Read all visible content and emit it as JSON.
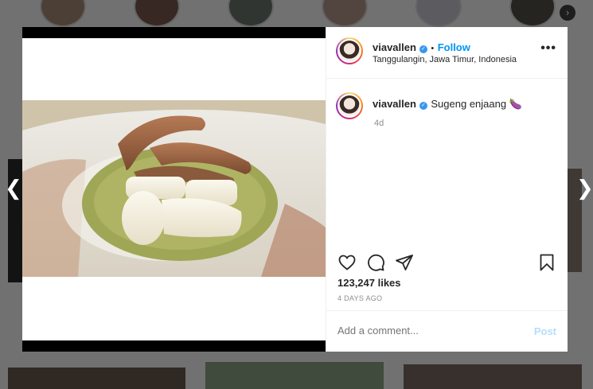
{
  "post": {
    "username": "viavallen",
    "follow_label": "Follow",
    "separator": "•",
    "location": "Tanggulangin, Jawa Timur, Indonesia",
    "caption": "Sugeng enjaang 🍆",
    "caption_age": "4d",
    "likes": "123,247 likes",
    "date": "4 DAYS AGO",
    "comment_placeholder": "Add a comment...",
    "post_label": "Post",
    "more_label": "•••"
  },
  "icons": {
    "verified": "verified-badge-icon",
    "like": "heart-icon",
    "comment": "comment-icon",
    "share": "send-icon",
    "save": "bookmark-icon",
    "more": "more-horizontal-icon",
    "prev": "chevron-left-icon",
    "next": "chevron-right-icon"
  },
  "colors": {
    "accent": "#0095f6",
    "verified": "#3897f0",
    "post_disabled": "#b2dffc"
  }
}
